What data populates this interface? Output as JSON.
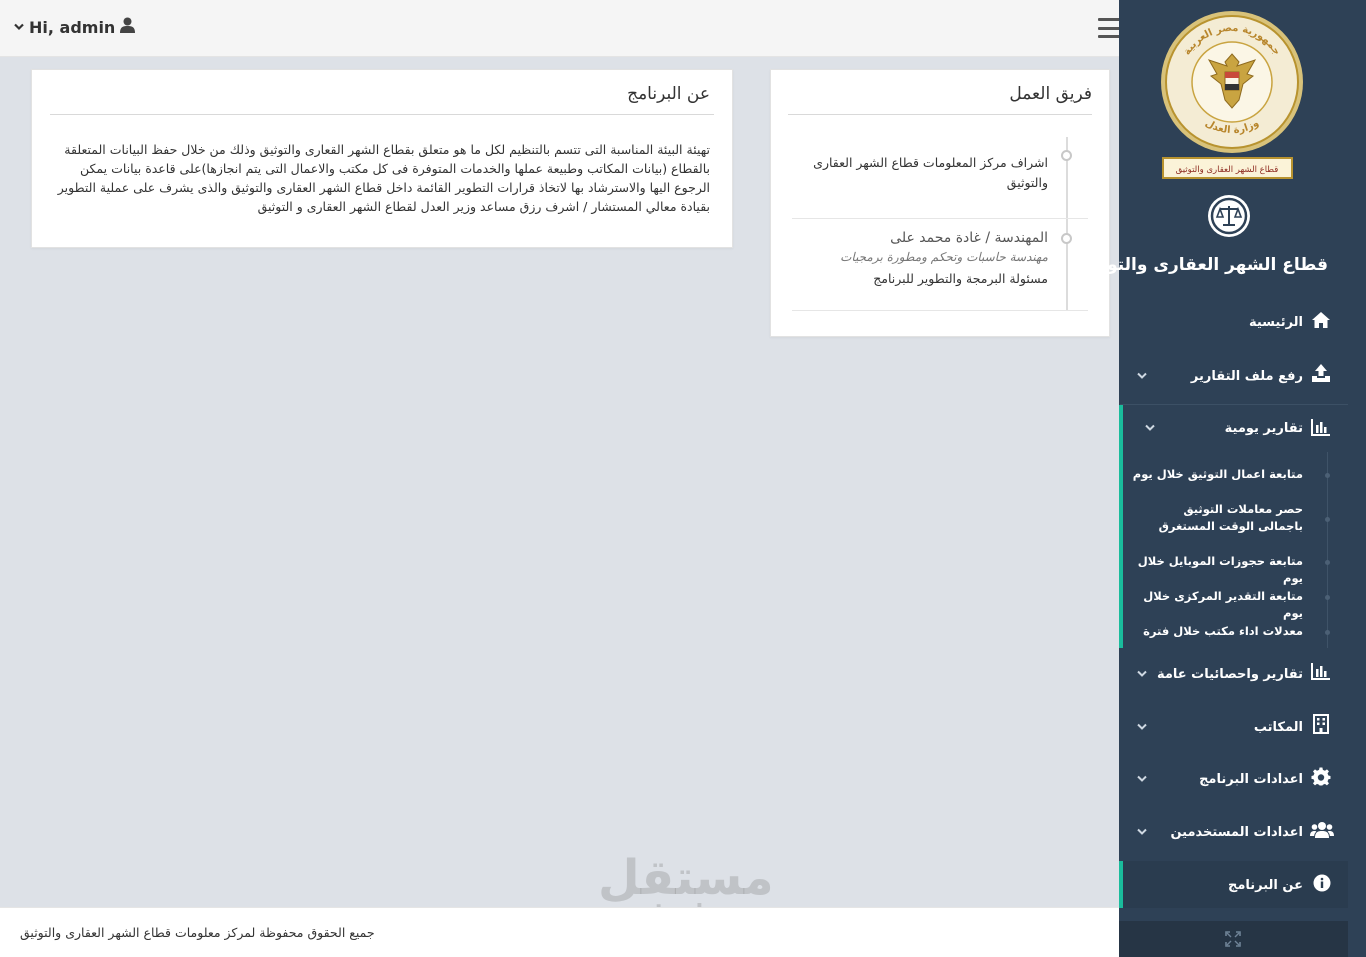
{
  "topbar": {
    "user_greeting": "Hi, admin",
    "chevron_glyph": "⌄"
  },
  "about_card": {
    "title": "عن البرنامج",
    "text": "تهيئة البيئة المناسبة التى تتسم بالتنظيم لكل ما هو متعلق بقطاع الشهر القعارى والتوثيق وذلك من خلال حفظ البيانات المتعلقة بالقطاع (بيانات المكاتب وطبيعة عملها والخدمات المتوفرة فى كل مكتب والاعمال التى يتم انجازها)على قاعدة بيانات يمكن الرجوع اليها والاسترشاد بها لاتخاذ قرارات التطوير القائمة داخل قطاع الشهر العقارى والتوثيق والذى يشرف على عملية التطوير بقيادة معالي المستشار / اشرف رزق مساعد وزير العدل لقطاع الشهر العقارى و التوثيق"
  },
  "team_card": {
    "title": "فريق العمل",
    "items": [
      {
        "text": "اشراف مركز المعلومات قطاع الشهر العقارى والتوثيق"
      },
      {
        "name": "المهندسة / غادة محمد على",
        "role": "مهندسة حاسبات وتحكم ومطورة برمجيات",
        "task": "مسئولة البرمجة والتطوير للبرنامج"
      }
    ]
  },
  "footer": {
    "text": "جميع الحقوق محفوظة لمركز معلومات قطاع الشهر العقارى والتوثيق"
  },
  "watermark": {
    "arabic": "مستقل",
    "latin": "mostaql.com"
  },
  "sidebar": {
    "title": "قطاع الشهر العقارى والتوثيق",
    "logo_text": {
      "top": "جمهورية مصر العربية",
      "bottom": "وزارة العدل",
      "banner": "قطاع الشهر العقارى والتوثيق"
    },
    "nav": [
      {
        "label": "الرئيسية",
        "icon": "home-icon",
        "has_chevron": false
      },
      {
        "label": "رفع ملف التقارير",
        "icon": "upload-icon",
        "has_chevron": true
      },
      {
        "label": "تقارير يومية",
        "icon": "bar-chart-icon",
        "has_chevron": true,
        "expanded": true
      },
      {
        "label": "تقارير واحصائيات عامة",
        "icon": "bar-chart-icon",
        "has_chevron": true
      },
      {
        "label": "المكاتب",
        "icon": "building-icon",
        "has_chevron": true
      },
      {
        "label": "اعدادات البرنامج",
        "icon": "gear-icon",
        "has_chevron": true
      },
      {
        "label": "اعدادات المستخدمين",
        "icon": "users-icon",
        "has_chevron": true
      },
      {
        "label": "عن البرنامج",
        "icon": "info-icon",
        "has_chevron": false,
        "active": true
      }
    ],
    "daily_reports_sub": [
      "متابعة اعمال التوثيق خلال يوم",
      "حصر معاملات التوثيق باجمالى الوقت المستغرق",
      "متابعة حجوزات الموبايل خلال يوم",
      "متابعة التقدير المركزى خلال يوم",
      "معدلات اداء مكتب خلال فترة"
    ],
    "colors": {
      "background": "#2e4156",
      "accent": "#1abc9c",
      "logo_gold": "#c9a441"
    }
  }
}
